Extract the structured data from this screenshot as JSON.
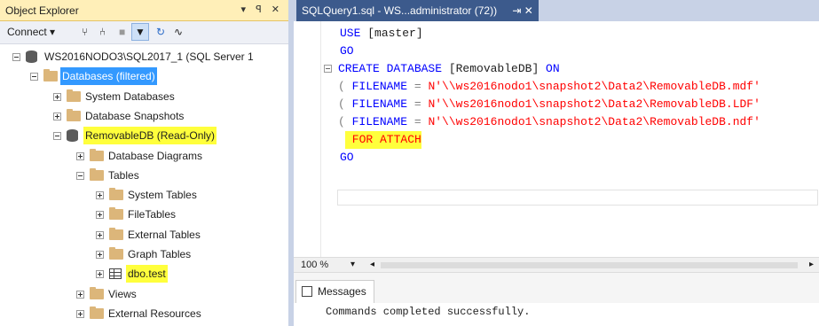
{
  "object_explorer": {
    "title": "Object Explorer",
    "pin_controls": "▾ ꟼ ✕",
    "toolbar": {
      "connect": "Connect ▾",
      "icons": [
        "connect-icon",
        "disconnect-icon",
        "stop-icon",
        "filter-icon",
        "refresh-icon",
        "activity-icon"
      ]
    },
    "tree": [
      {
        "label": "WS2016NODO3\\SQL2017_1 (SQL Server 1",
        "icon": "server-icon",
        "expanded": true
      },
      {
        "label": "Databases (filtered)",
        "icon": "folder-icon",
        "expanded": true,
        "selected": true
      },
      {
        "label": "System Databases",
        "icon": "folder-icon",
        "expanded": false
      },
      {
        "label": "Database Snapshots",
        "icon": "folder-icon",
        "expanded": false
      },
      {
        "label": "RemovableDB (Read-Only)",
        "icon": "database-icon",
        "expanded": true,
        "highlighted": true
      },
      {
        "label": "Database Diagrams",
        "icon": "folder-icon",
        "expanded": false
      },
      {
        "label": "Tables",
        "icon": "folder-icon",
        "expanded": true
      },
      {
        "label": "System Tables",
        "icon": "folder-icon",
        "expanded": false
      },
      {
        "label": "FileTables",
        "icon": "folder-icon",
        "expanded": false
      },
      {
        "label": "External Tables",
        "icon": "folder-icon",
        "expanded": false
      },
      {
        "label": "Graph Tables",
        "icon": "folder-icon",
        "expanded": false
      },
      {
        "label": "dbo.test",
        "icon": "table-icon",
        "expanded": false,
        "highlighted": true
      },
      {
        "label": "Views",
        "icon": "folder-icon",
        "expanded": false
      },
      {
        "label": "External Resources",
        "icon": "folder-icon",
        "expanded": false
      }
    ]
  },
  "editor": {
    "tab_title": "SQLQuery1.sql - WS...administrator (72))",
    "tab_controls": "⇥ ✕",
    "lines": [
      {
        "parts": [
          {
            "t": "USE ",
            "c": "kw"
          },
          {
            "t": "[master]",
            "c": "plain"
          }
        ]
      },
      {
        "parts": [
          {
            "t": "GO",
            "c": "kw"
          }
        ]
      },
      {
        "parts": [
          {
            "t": "CREATE DATABASE ",
            "c": "kw"
          },
          {
            "t": "[RemovableDB] ",
            "c": "plain"
          },
          {
            "t": "ON",
            "c": "kw"
          }
        ]
      },
      {
        "parts": [
          {
            "t": "( ",
            "c": "gray"
          },
          {
            "t": "FILENAME ",
            "c": "kw"
          },
          {
            "t": "= ",
            "c": "gray"
          },
          {
            "t": "N'\\\\ws2016nodo1\\snapshot2\\Data2\\RemovableDB.mdf'",
            "c": "str"
          }
        ]
      },
      {
        "parts": [
          {
            "t": "( ",
            "c": "gray"
          },
          {
            "t": "FILENAME ",
            "c": "kw"
          },
          {
            "t": "= ",
            "c": "gray"
          },
          {
            "t": "N'\\\\ws2016nodo1\\snapshot2\\Data2\\RemovableDB.LDF'",
            "c": "str"
          }
        ]
      },
      {
        "parts": [
          {
            "t": "( ",
            "c": "gray"
          },
          {
            "t": "FILENAME ",
            "c": "kw"
          },
          {
            "t": "= ",
            "c": "gray"
          },
          {
            "t": "N'\\\\ws2016nodo1\\snapshot2\\Data2\\RemovableDB.ndf'",
            "c": "str"
          }
        ]
      },
      {
        "parts": [
          {
            "t": " FOR ATTACH",
            "c": "str"
          }
        ],
        "highlighted": true
      },
      {
        "parts": [
          {
            "t": "GO",
            "c": "kw"
          }
        ]
      }
    ]
  },
  "zoom": "100 %",
  "results": {
    "tab_label": "Messages",
    "message": "Commands completed successfully."
  },
  "colors": {
    "highlight": "#ffff3c",
    "selection": "#3399ff",
    "keyword": "#0000ff",
    "string": "#ff0000",
    "tab_active": "#3c5a8c",
    "panel_title": "#ffefb8"
  }
}
